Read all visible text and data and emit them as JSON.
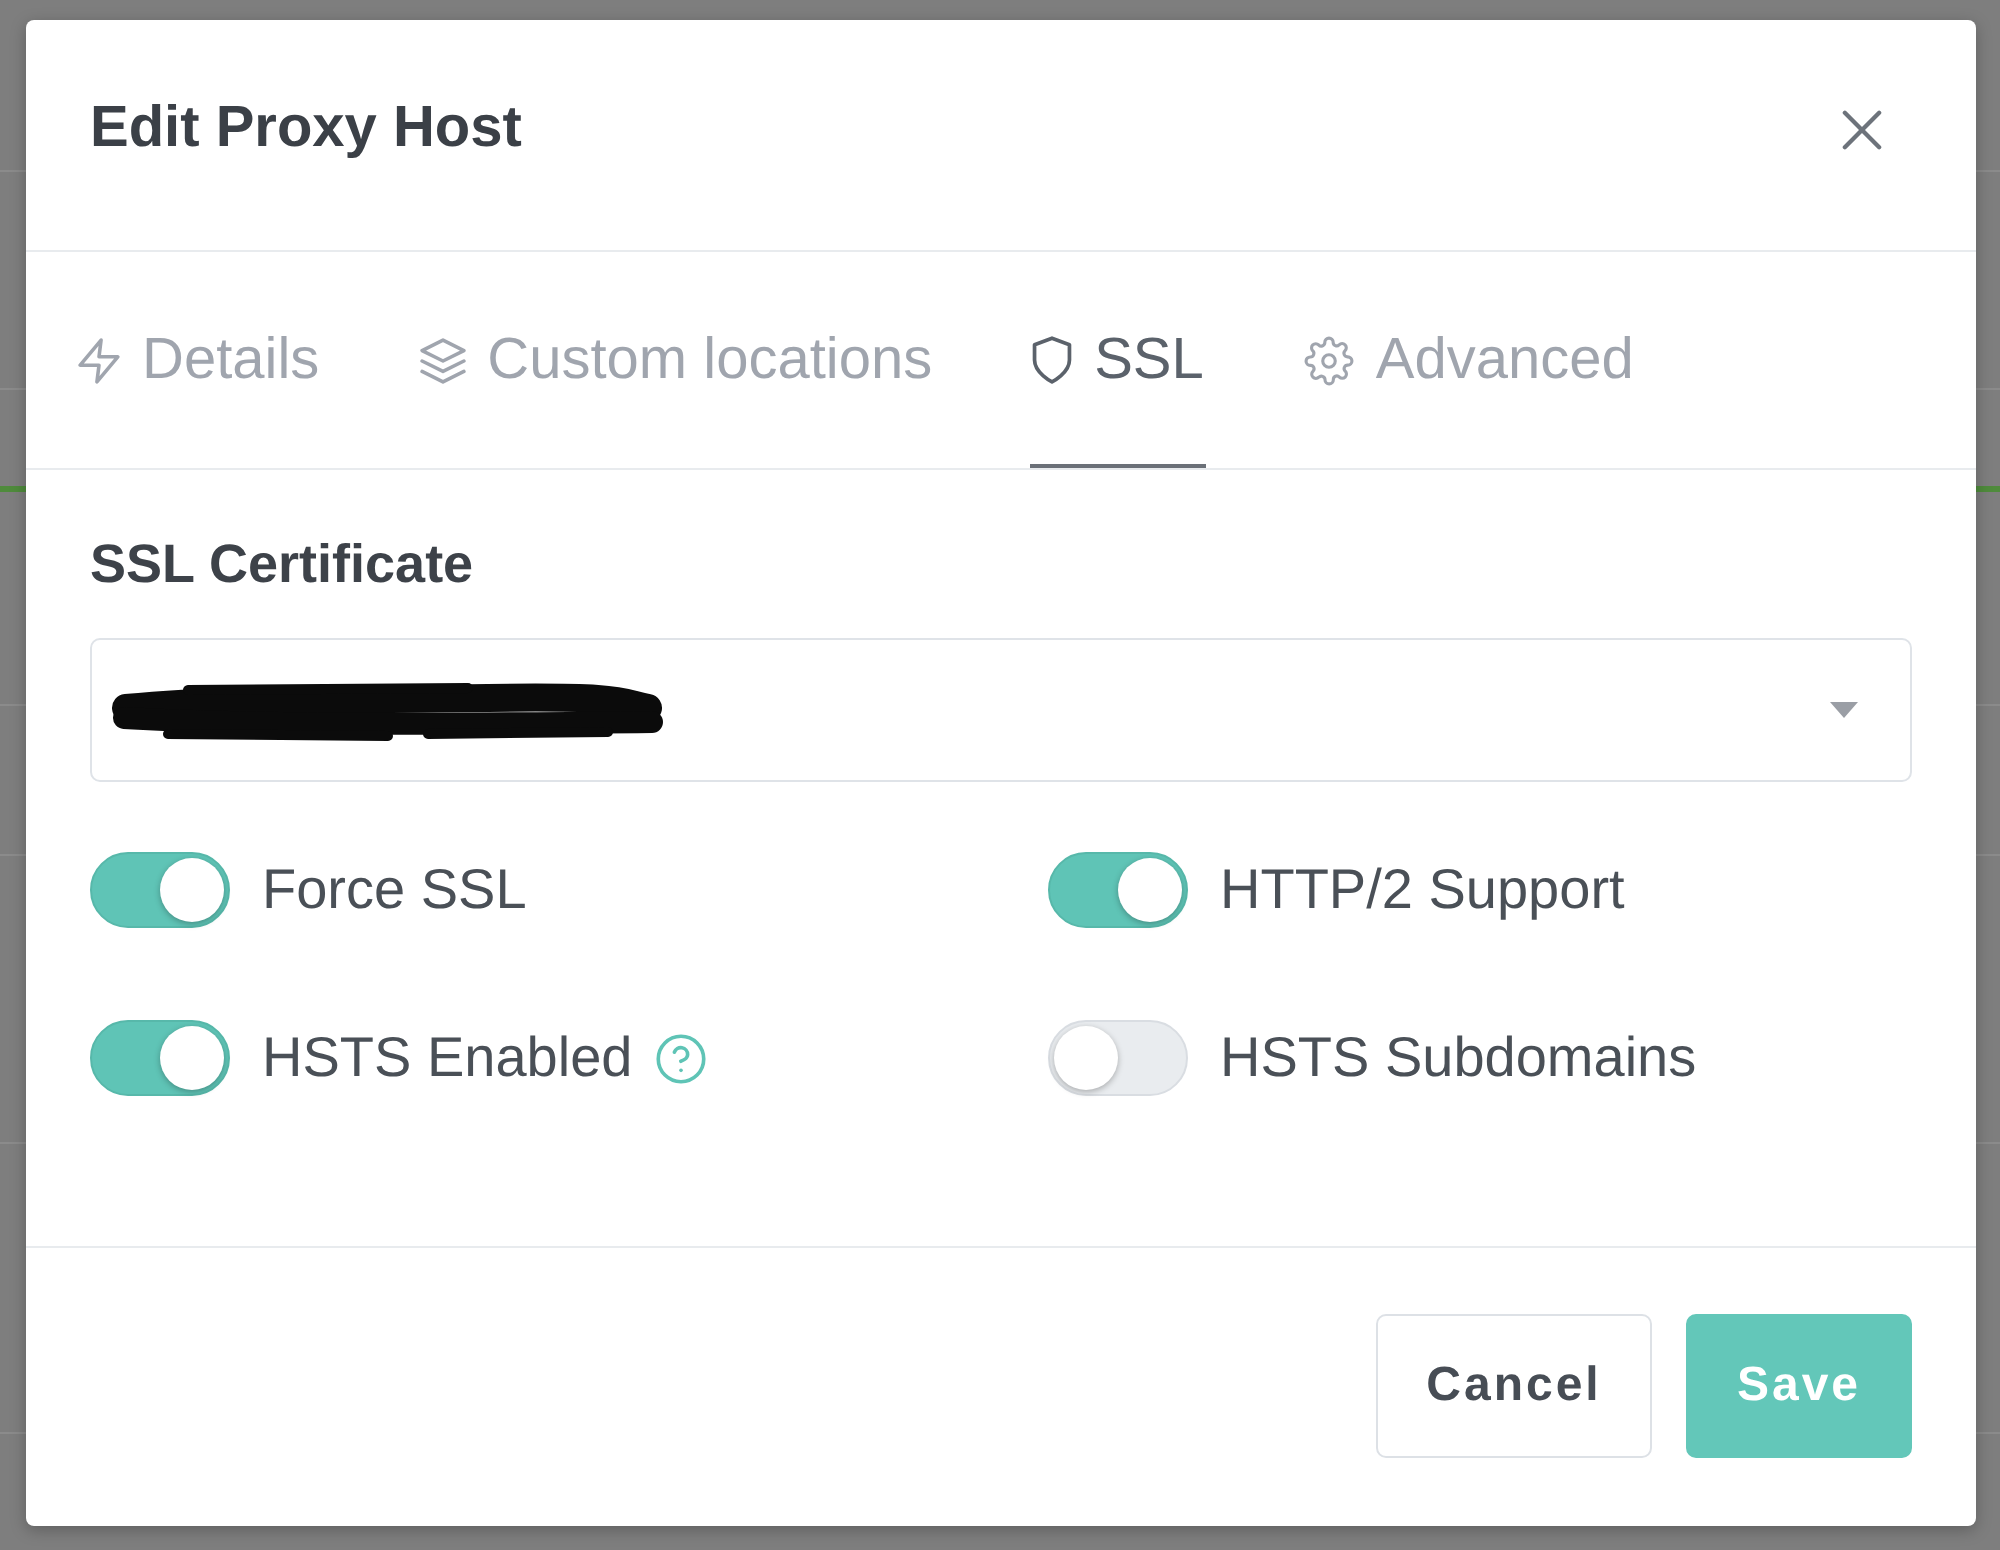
{
  "dialog": {
    "title": "Edit Proxy Host"
  },
  "tabs": [
    {
      "label": "Details",
      "kind": "details",
      "selected": false
    },
    {
      "label": "Custom locations",
      "kind": "locations",
      "selected": false
    },
    {
      "label": "SSL",
      "kind": "ssl",
      "selected": true
    },
    {
      "label": "Advanced",
      "kind": "advanced",
      "selected": false
    }
  ],
  "ssl_certificate": {
    "label": "SSL Certificate",
    "value_redacted": true
  },
  "options": [
    {
      "label": "Force SSL",
      "on": true,
      "help": false
    },
    {
      "label": "HTTP/2 Support",
      "on": true,
      "help": false
    },
    {
      "label": "HSTS Enabled",
      "on": true,
      "help": true
    },
    {
      "label": "HSTS Subdomains",
      "on": false,
      "help": false
    }
  ],
  "buttons": [
    {
      "label": "Cancel",
      "kind": "secondary"
    },
    {
      "label": "Save",
      "kind": "primary"
    }
  ]
}
